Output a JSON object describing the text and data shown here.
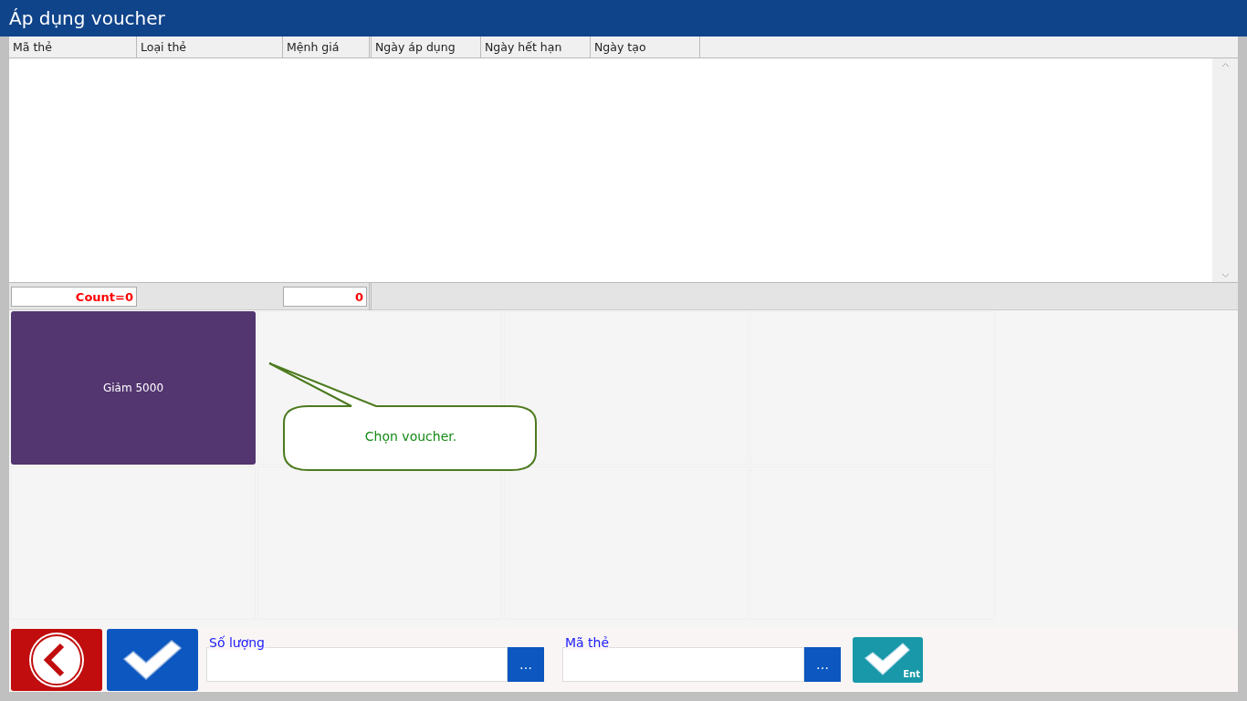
{
  "window": {
    "title": "Áp dụng voucher"
  },
  "table": {
    "columns": [
      "Mã thẻ",
      "Loại thẻ",
      "Mệnh giá",
      "Ngày áp dụng",
      "Ngày hết hạn",
      "Ngày tạo"
    ]
  },
  "summary": {
    "count": "Count=0",
    "total": "0"
  },
  "vouchers": [
    {
      "label": "Giảm 5000"
    }
  ],
  "tooltip": {
    "text": "Chọn voucher."
  },
  "fields": [
    {
      "label": "Số lượng",
      "button": "…"
    },
    {
      "label": "Mã thẻ",
      "button": "…"
    }
  ],
  "enter_button": {
    "label": "Ent"
  }
}
